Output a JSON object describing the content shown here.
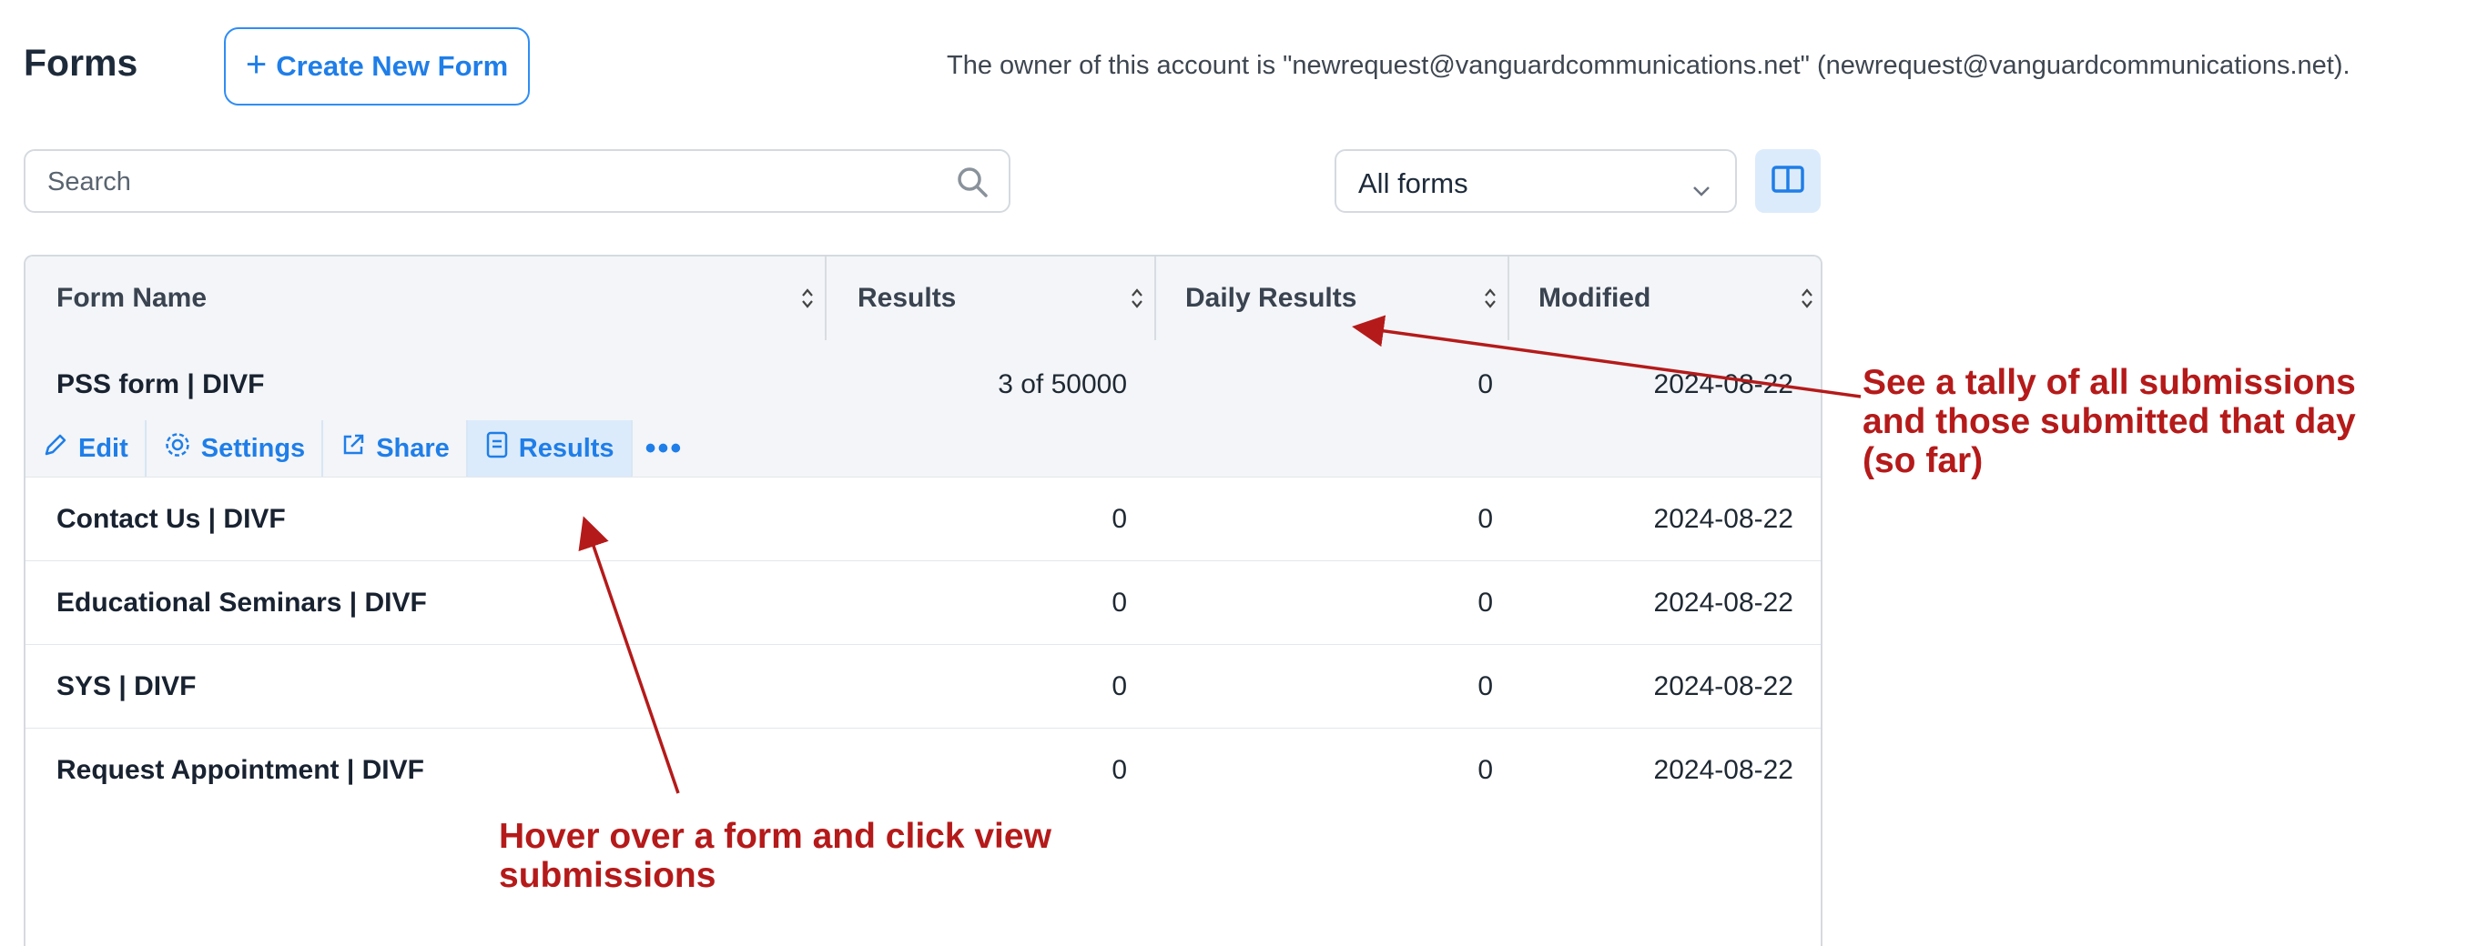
{
  "header": {
    "title": "Forms",
    "create_button_label": "Create New Form",
    "owner_text": "The owner of this account is \"newrequest@vanguardcommunications.net\" (newrequest@vanguardcommunications.net)."
  },
  "search": {
    "placeholder": "Search"
  },
  "filter": {
    "selected": "All forms"
  },
  "table": {
    "columns": [
      "Form Name",
      "Results",
      "Daily Results",
      "Modified"
    ],
    "rows": [
      {
        "name": "PSS form | DIVF",
        "results": "3 of 50000",
        "daily": "0",
        "modified": "2024-08-22"
      },
      {
        "name": "Contact Us | DIVF",
        "results": "0",
        "daily": "0",
        "modified": "2024-08-22"
      },
      {
        "name": "Educational Seminars | DIVF",
        "results": "0",
        "daily": "0",
        "modified": "2024-08-22"
      },
      {
        "name": "SYS | DIVF",
        "results": "0",
        "daily": "0",
        "modified": "2024-08-22"
      },
      {
        "name": "Request Appointment | DIVF",
        "results": "0",
        "daily": "0",
        "modified": "2024-08-22"
      }
    ],
    "row_actions": [
      "Edit",
      "Settings",
      "Share",
      "Results"
    ]
  },
  "annotations": {
    "tally_line1": "See a tally of all submissions",
    "tally_line2": "and those submitted that day",
    "tally_line3": "(so far)",
    "hover_line1": "Hover over a form and click view",
    "hover_line2": "submissions"
  },
  "colors": {
    "accent": "#1f7ee8",
    "annotation": "#b51a1a"
  },
  "icons": [
    "plus-icon",
    "search-icon",
    "chevron-down-icon",
    "columns-icon",
    "sort-icon",
    "pencil-icon",
    "gear-icon",
    "external-link-icon",
    "document-icon",
    "more-icon"
  ]
}
